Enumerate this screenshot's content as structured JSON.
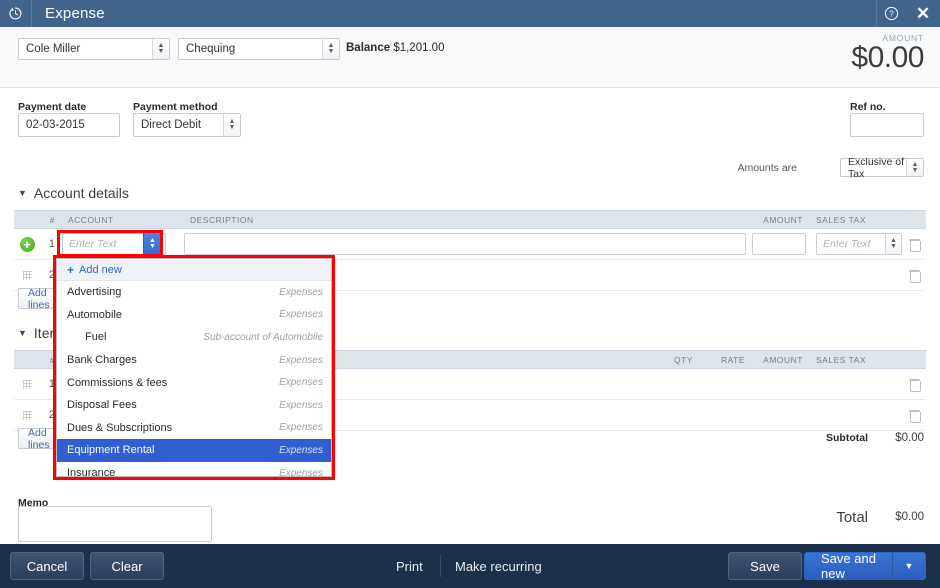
{
  "titlebar": {
    "icon": "clock-history-icon",
    "title": "Expense",
    "help_icon": "question-circle-icon",
    "close_icon": "close-icon"
  },
  "header": {
    "customer": "Cole Miller",
    "bank_account": "Chequing",
    "balance_label": "Balance",
    "balance_value": "$1,201.00",
    "amount_label": "AMOUNT",
    "amount_value": "$0.00"
  },
  "form": {
    "payment_date_label": "Payment date",
    "payment_date_value": "02-03-2015",
    "payment_method_label": "Payment method",
    "payment_method_value": "Direct Debit",
    "ref_no_label": "Ref no.",
    "ref_no_value": "",
    "amounts_are_label": "Amounts are",
    "amounts_are_value": "Exclusive of Tax"
  },
  "account_details": {
    "section_title": "Account details",
    "caret": "▼",
    "columns": {
      "num": "#",
      "account": "ACCOUNT",
      "description": "DESCRIPTION",
      "amount": "AMOUNT",
      "sales_tax": "SALES TAX"
    },
    "rows": [
      {
        "num": "1",
        "account_placeholder": "Enter Text",
        "description": "",
        "amount": "",
        "sales_tax_placeholder": "Enter Text"
      },
      {
        "num": "2",
        "account_placeholder": "",
        "description": "",
        "amount": "",
        "sales_tax_placeholder": ""
      }
    ],
    "add_lines_label": "Add lines"
  },
  "account_dropdown": {
    "add_new_label": "Add new",
    "add_new_icon": "plus-icon",
    "options": [
      {
        "name": "Advertising",
        "type": "Expenses",
        "sub": false,
        "selected": false
      },
      {
        "name": "Automobile",
        "type": "Expenses",
        "sub": false,
        "selected": false
      },
      {
        "name": "Fuel",
        "type": "Sub-account of Automobile",
        "sub": true,
        "selected": false
      },
      {
        "name": "Bank Charges",
        "type": "Expenses",
        "sub": false,
        "selected": false
      },
      {
        "name": "Commissions & fees",
        "type": "Expenses",
        "sub": false,
        "selected": false
      },
      {
        "name": "Disposal Fees",
        "type": "Expenses",
        "sub": false,
        "selected": false
      },
      {
        "name": "Dues & Subscriptions",
        "type": "Expenses",
        "sub": false,
        "selected": false
      },
      {
        "name": "Equipment Rental",
        "type": "Expenses",
        "sub": false,
        "selected": true
      },
      {
        "name": "Insurance",
        "type": "Expenses",
        "sub": false,
        "selected": false
      }
    ]
  },
  "item_details": {
    "section_title": "Item details",
    "caret": "▼",
    "columns": {
      "num": "#",
      "qty": "QTY",
      "rate": "RATE",
      "amount": "AMOUNT",
      "sales_tax": "SALES TAX"
    },
    "rows": [
      {
        "num": "1",
        "qty": "",
        "rate": "",
        "amount": "",
        "sales_tax": ""
      },
      {
        "num": "2",
        "qty": "",
        "rate": "",
        "amount": "",
        "sales_tax": ""
      }
    ],
    "add_lines_label": "Add lines"
  },
  "totals": {
    "subtotal_label": "Subtotal",
    "subtotal_value": "$0.00",
    "total_label": "Total",
    "total_value": "$0.00"
  },
  "memo": {
    "label": "Memo",
    "value": ""
  },
  "footer": {
    "cancel": "Cancel",
    "clear": "Clear",
    "print": "Print",
    "make_recurring": "Make recurring",
    "save": "Save",
    "save_and_new": "Save and new",
    "save_caret_icon": "chevron-down-icon"
  },
  "colors": {
    "titlebar": "#41658a",
    "footer": "#1c304c",
    "primary_button": "#2a5fbd",
    "highlight_selected": "#2f5fd0",
    "annotation_red": "#ff0000",
    "link_blue": "#2b6bd4"
  }
}
